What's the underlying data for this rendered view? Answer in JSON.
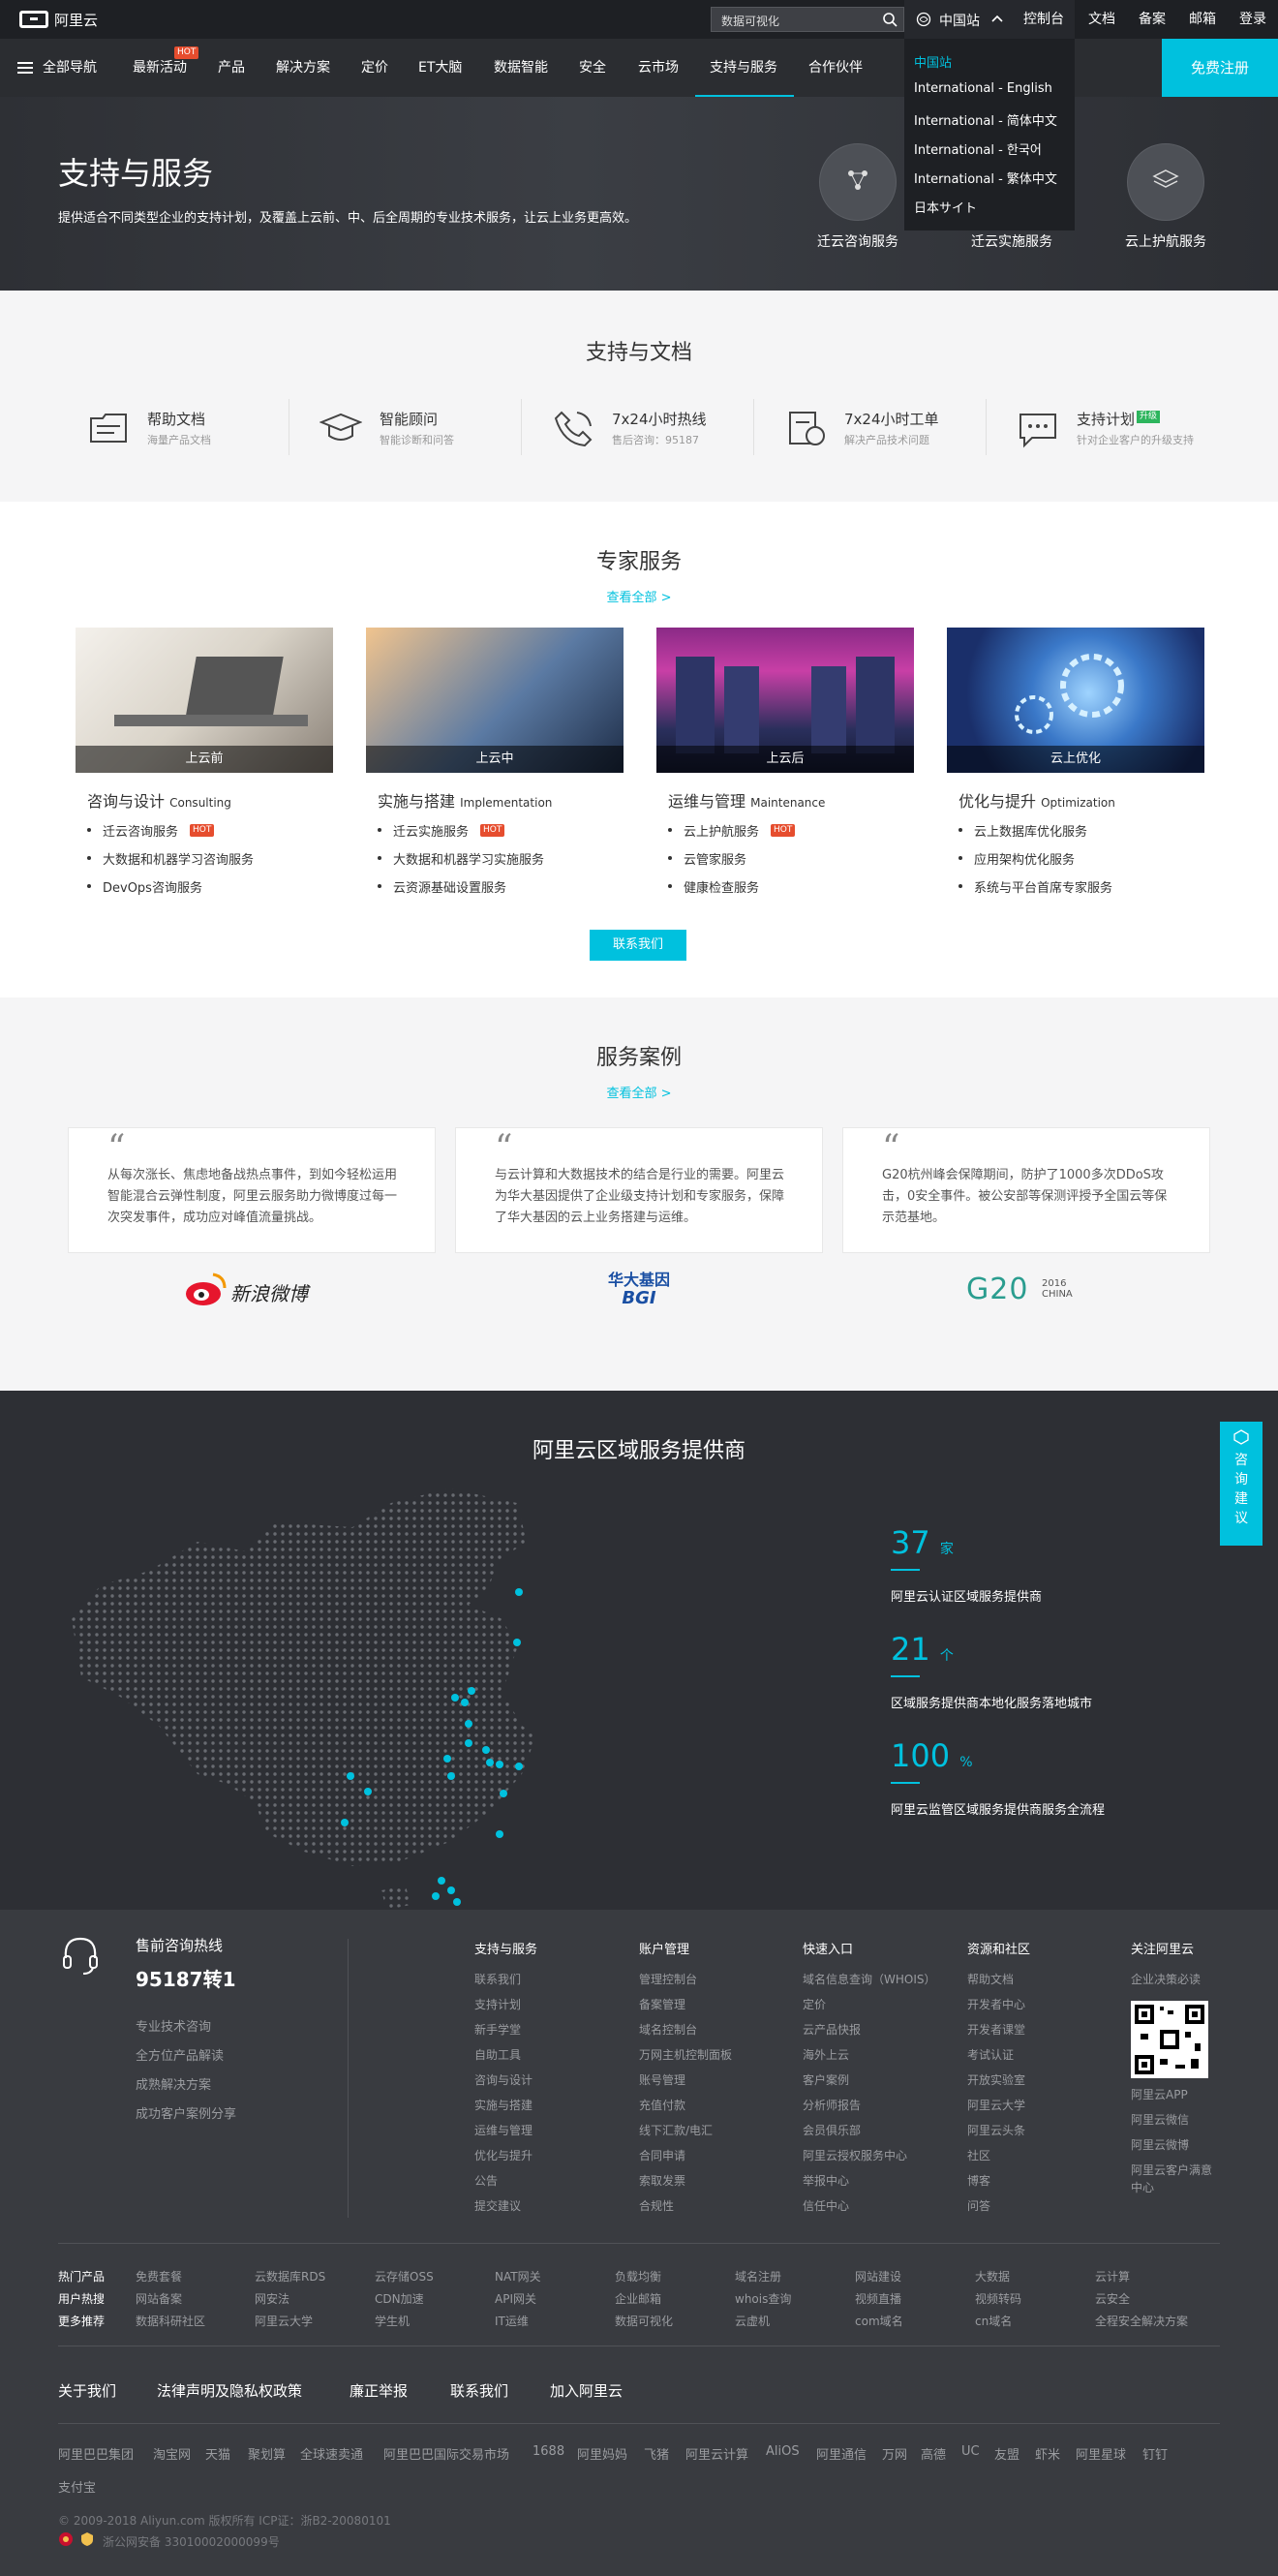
{
  "header": {
    "logo": "阿里云",
    "search_placeholder": "数据可视化",
    "region": "中国站",
    "links": [
      "控制台",
      "文档",
      "备案",
      "邮箱",
      "登录"
    ],
    "register": "免费注册"
  },
  "region_menu": [
    "中国站",
    "International - English",
    "International - 简体中文",
    "International - 한국어",
    "International - 繁体中文",
    "日本サイト"
  ],
  "nav": {
    "all": "全部导航",
    "items": [
      "最新活动",
      "产品",
      "解决方案",
      "定价",
      "ET大脑",
      "数据智能",
      "安全",
      "云市场",
      "支持与服务",
      "合作伙伴"
    ],
    "hot_badge": "HOT",
    "active": "支持与服务"
  },
  "hero": {
    "title": "支持与服务",
    "subtitle": "提供适合不同类型企业的支持计划，及覆盖上云前、中、后全周期的专业技术服务，让云上业务更高效。",
    "services": [
      "迁云咨询服务",
      "迁云实施服务",
      "云上护航服务"
    ]
  },
  "docs": {
    "title": "支持与文档",
    "cards": [
      {
        "title": "帮助文档",
        "sub": "海量产品文档"
      },
      {
        "title": "智能顾问",
        "sub": "智能诊断和问答"
      },
      {
        "title": "7x24小时热线",
        "sub": "售后咨询：95187"
      },
      {
        "title": "7x24小时工单",
        "sub": "解决产品技术问题"
      },
      {
        "title": "支持计划",
        "sub": "针对企业客户的升级支持",
        "badge": "升级"
      }
    ]
  },
  "expert": {
    "title": "专家服务",
    "more": "查看全部 >",
    "contact": "联系我们",
    "hot": "HOT",
    "columns": [
      {
        "caption": "上云前",
        "title": "咨询与设计",
        "en": "Consulting",
        "items": [
          "迁云咨询服务",
          "大数据和机器学习咨询服务",
          "DevOps咨询服务"
        ],
        "hot": [
          0
        ]
      },
      {
        "caption": "上云中",
        "title": "实施与搭建",
        "en": "Implementation",
        "items": [
          "迁云实施服务",
          "大数据和机器学习实施服务",
          "云资源基础设置服务"
        ],
        "hot": [
          0
        ]
      },
      {
        "caption": "上云后",
        "title": "运维与管理",
        "en": "Maintenance",
        "items": [
          "云上护航服务",
          "云管家服务",
          "健康检查服务"
        ],
        "hot": [
          0
        ]
      },
      {
        "caption": "云上优化",
        "title": "优化与提升",
        "en": "Optimization",
        "items": [
          "云上数据库优化服务",
          "应用架构优化服务",
          "系统与平台首席专家服务"
        ],
        "hot": []
      }
    ]
  },
  "cases": {
    "title": "服务案例",
    "more": "查看全部 >",
    "items": [
      {
        "text": "从每次涨长、焦虑地备战热点事件，到如今轻松运用智能混合云弹性制度，阿里云服务助力微博度过每一次突发事件，成功应对峰值流量挑战。",
        "brand": "新浪微博"
      },
      {
        "text": "与云计算和大数据技术的结合是行业的需要。阿里云为华大基因提供了企业级支持计划和专家服务，保障了华大基因的云上业务搭建与运维。",
        "brand": "华大基因",
        "brand2": "BGI"
      },
      {
        "text": "G20杭州峰会保障期间，防护了1000多次DDoS攻击，0安全事件。被公安部等保测评授予全国云等保示范基地。",
        "brand": "G20",
        "brand2": "2016 CHINA"
      }
    ]
  },
  "regional": {
    "title": "阿里云区域服务提供商",
    "stats": [
      {
        "num": "37",
        "unit": "家",
        "label": "阿里云认证区域服务提供商"
      },
      {
        "num": "21",
        "unit": "个",
        "label": "区域服务提供商本地化服务落地城市"
      },
      {
        "num": "100",
        "unit": "%",
        "label": "阿里云监管区域服务提供商服务全流程"
      }
    ],
    "consult": "咨询建议"
  },
  "footer": {
    "hotline_title": "售前咨询热线",
    "hotline": "95187转1",
    "left_links": [
      "专业技术咨询",
      "全方位产品解读",
      "成熟解决方案",
      "成功客户案例分享"
    ],
    "columns": [
      {
        "title": "支持与服务",
        "links": [
          "联系我们",
          "支持计划",
          "新手学堂",
          "自助工具",
          "咨询与设计",
          "实施与搭建",
          "运维与管理",
          "优化与提升",
          "公告",
          "提交建议"
        ]
      },
      {
        "title": "账户管理",
        "links": [
          "管理控制台",
          "备案管理",
          "域名控制台",
          "万网主机控制面板",
          "账号管理",
          "充值付款",
          "线下汇款/电汇",
          "合同申请",
          "索取发票",
          "合规性"
        ]
      },
      {
        "title": "快速入口",
        "links": [
          "域名信息查询（WHOIS）",
          "定价",
          "云产品快报",
          "海外上云",
          "客户案例",
          "分析师报告",
          "会员俱乐部",
          "阿里云授权服务中心",
          "举报中心",
          "信任中心"
        ]
      },
      {
        "title": "资源和社区",
        "links": [
          "帮助文档",
          "开发者中心",
          "开发者课堂",
          "考试认证",
          "开放实验室",
          "阿里云大学",
          "阿里云头条",
          "社区",
          "博客",
          "问答"
        ]
      },
      {
        "title": "关注阿里云",
        "links": [
          "企业决策必读",
          "阿里云APP",
          "阿里云微信",
          "阿里云微博",
          "阿里云客户满意",
          "中心"
        ]
      }
    ],
    "tags": {
      "labels": [
        "热门产品",
        "用户热搜",
        "更多推荐"
      ],
      "rows": [
        [
          "免费套餐",
          "云数据库RDS",
          "云存储OSS",
          "NAT网关",
          "负载均衡",
          "域名注册",
          "网站建设",
          "大数据",
          "云计算"
        ],
        [
          "网站备案",
          "网安法",
          "CDN加速",
          "API网关",
          "企业邮箱",
          "whois查询",
          "视频直播",
          "视频转码",
          "云安全"
        ],
        [
          "数据科研社区",
          "阿里云大学",
          "学生机",
          "IT运维",
          "数据可视化",
          "云虚机",
          "com域名",
          "cn域名",
          "全程安全解决方案"
        ]
      ]
    },
    "bottom_links": [
      "关于我们",
      "法律声明及隐私权政策",
      "廉正举报",
      "联系我们",
      "加入阿里云"
    ],
    "group": [
      "阿里巴巴集团",
      "淘宝网",
      "天猫",
      "聚划算",
      "全球速卖通",
      "阿里巴巴国际交易市场",
      "1688",
      "阿里妈妈",
      "飞猪",
      "阿里云计算",
      "AliOS",
      "阿里通信",
      "万网",
      "高德",
      "UC",
      "友盟",
      "虾米",
      "阿里星球",
      "钉钉",
      "支付宝"
    ],
    "copyright": "© 2009-2018 Aliyun.com 版权所有 ICP证：浙B2-20080101",
    "beian": "浙公网安备 33010002000099号"
  },
  "colors": {
    "accent": "#00c1de",
    "dark": "#2b2d31",
    "hot": "#e64d2e"
  }
}
